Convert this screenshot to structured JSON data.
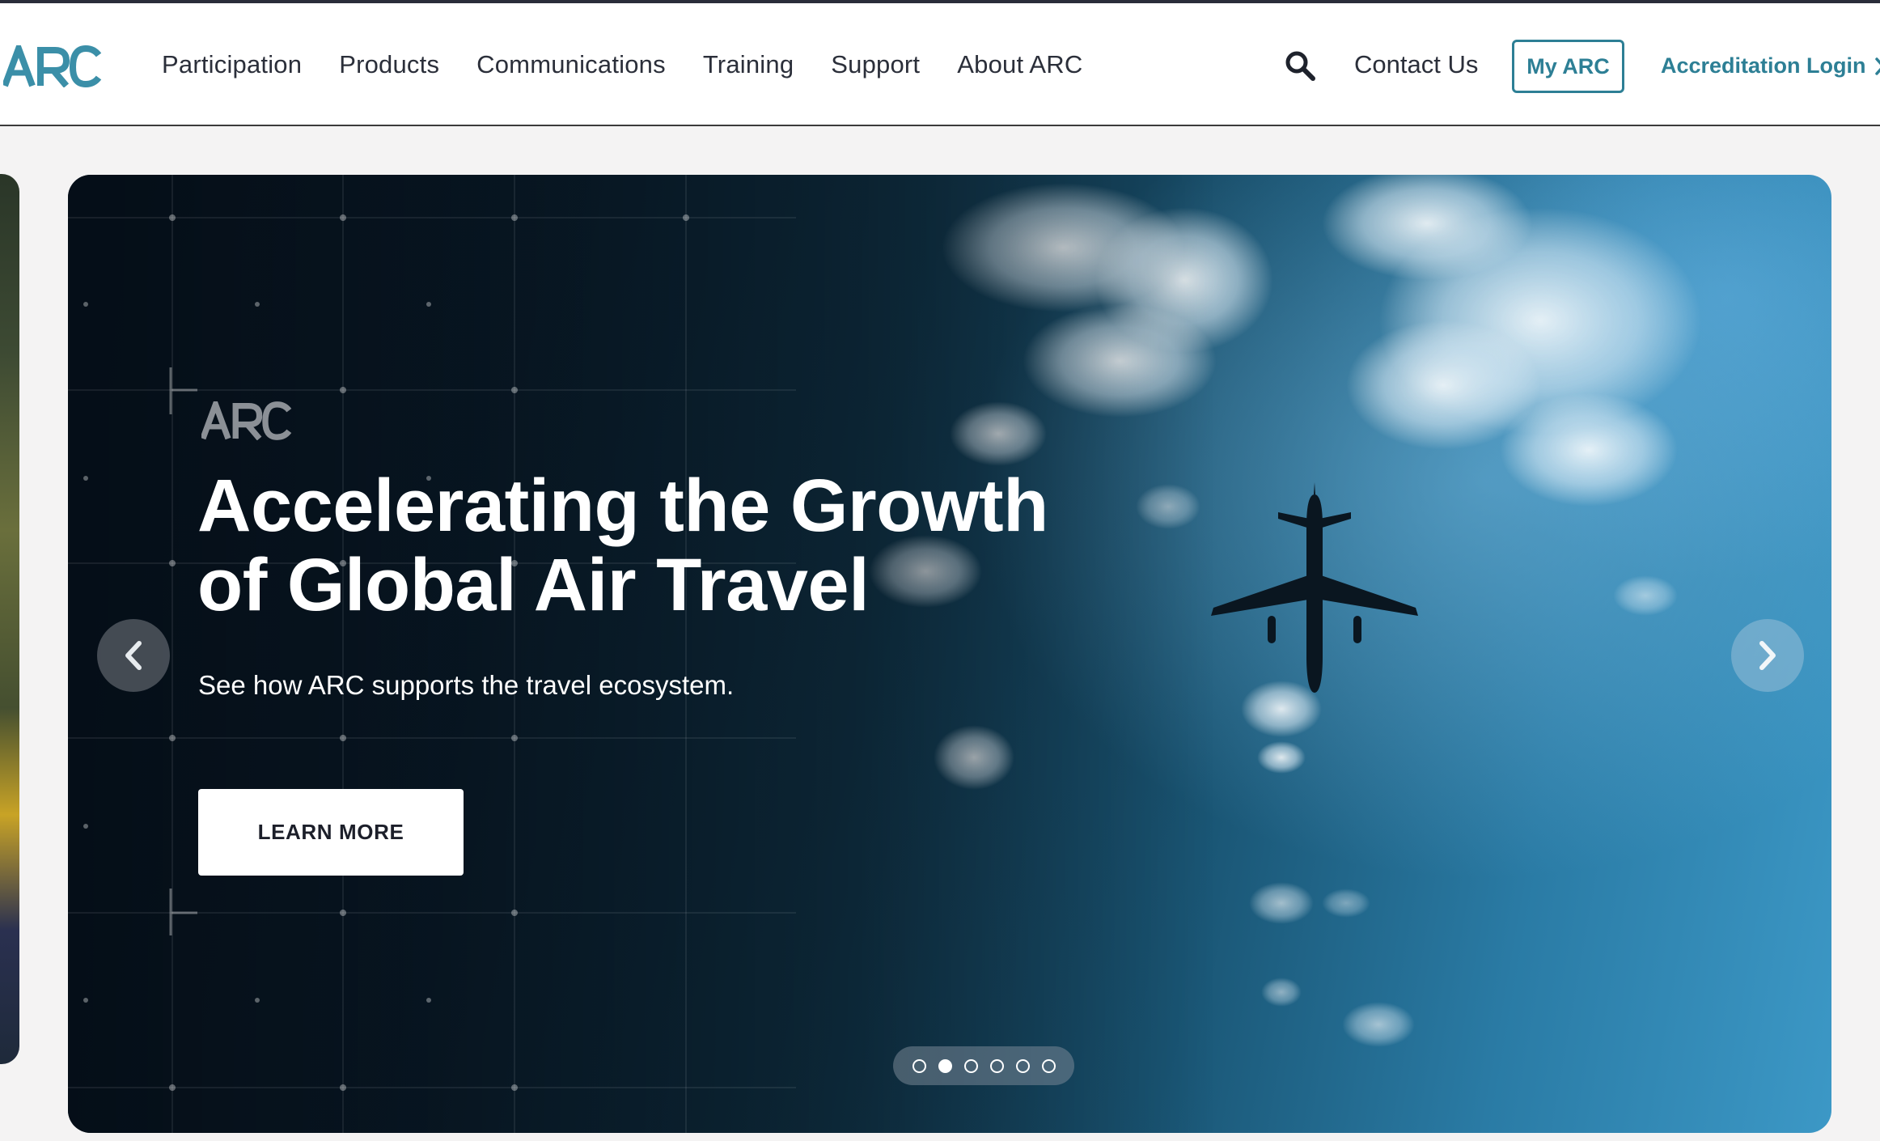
{
  "brand": {
    "logo_text": "ARC",
    "accent_color": "#2d7f95",
    "logo_color": "#3b8fa8"
  },
  "nav": {
    "items": [
      {
        "label": "Participation"
      },
      {
        "label": "Products"
      },
      {
        "label": "Communications"
      },
      {
        "label": "Training"
      },
      {
        "label": "Support"
      },
      {
        "label": "About ARC"
      }
    ]
  },
  "header_actions": {
    "search_icon": "search-icon",
    "contact_label": "Contact Us",
    "myarc_label": "My ARC",
    "accreditation_label": "Accreditation Login",
    "accreditation_icon": "chevron-right-icon"
  },
  "hero": {
    "brand_mark": "ARC",
    "headline_line1": "Accelerating the Growth",
    "headline_line2": "of Global Air Travel",
    "subtext": "See how ARC supports the travel ecosystem.",
    "cta_label": "LEARN MORE",
    "prev_icon": "chevron-left-icon",
    "next_icon": "chevron-right-icon",
    "image_subject": "airplane-icon"
  },
  "carousel": {
    "slide_count": 6,
    "active_index": 1
  }
}
